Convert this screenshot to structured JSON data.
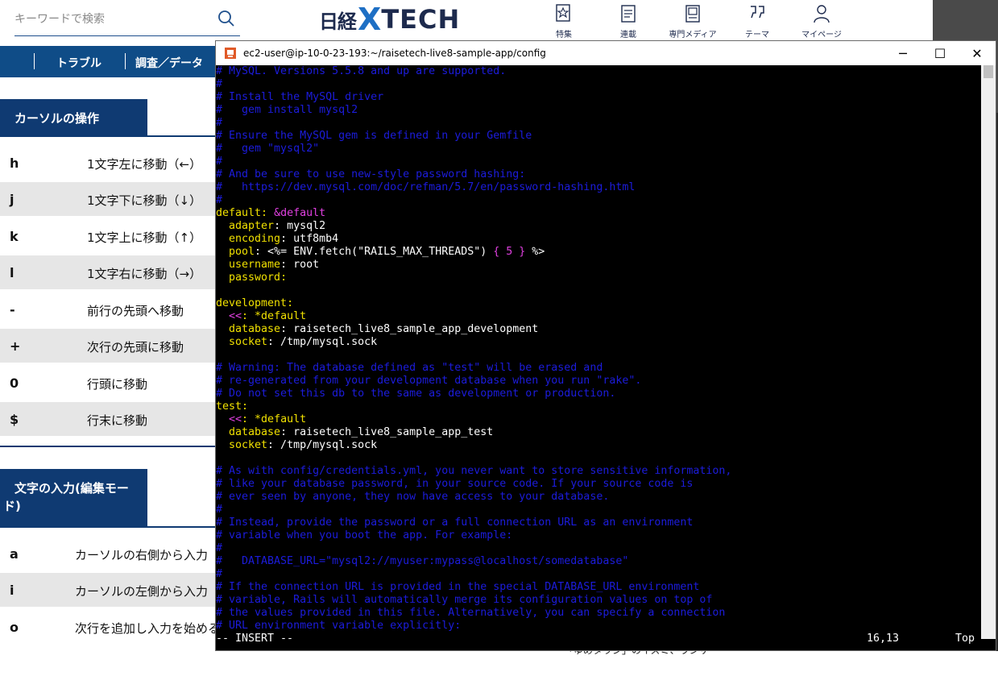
{
  "header": {
    "search_placeholder": "キーワードで検索",
    "logo_nikkei": "日経",
    "logo_x": "X",
    "logo_tech": "TECH",
    "nav": [
      {
        "label": "特集",
        "icon": "star-doc-icon"
      },
      {
        "label": "連載",
        "icon": "document-icon"
      },
      {
        "label": "専門メディア",
        "icon": "magazine-icon"
      },
      {
        "label": "テーマ",
        "icon": "theme-icon"
      },
      {
        "label": "マイページ",
        "icon": "user-icon"
      }
    ]
  },
  "bluebar": {
    "items": [
      "トラブル",
      "調査／データ"
    ]
  },
  "section1": {
    "title": "カーソルの操作",
    "rows": [
      {
        "key": "h",
        "desc": "1文字左に移動（←）"
      },
      {
        "key": "j",
        "desc": "1文字下に移動（↓）"
      },
      {
        "key": "k",
        "desc": "1文字上に移動（↑）"
      },
      {
        "key": "l",
        "desc": "1文字右に移動（→）"
      },
      {
        "key": "-",
        "desc": "前行の先頭へ移動"
      },
      {
        "key": "+",
        "desc": "次行の先頭に移動"
      },
      {
        "key": "0",
        "desc": "行頭に移動"
      },
      {
        "key": "$",
        "desc": "行末に移動"
      }
    ]
  },
  "section2": {
    "title_line1": "文字の入力(編集モー",
    "title_line2": "ド)",
    "rows": [
      {
        "key": "a",
        "desc": "カーソルの右側から入力"
      },
      {
        "key": "i",
        "desc": "カーソルの左側から入力"
      },
      {
        "key": "o",
        "desc": "次行を追加し入力を始める"
      }
    ]
  },
  "bottom_peek": "「ゆめタウン」のイズミ、ランサ",
  "window": {
    "title": "ec2-user@ip-10-0-23-193:~/raisetech-live8-sample-app/config",
    "minimize": "─",
    "maximize": "☐",
    "close": "✕"
  },
  "terminal": {
    "l01": "# MySQL. Versions 5.5.8 and up are supported.",
    "l02": "#",
    "l03": "# Install the MySQL driver",
    "l04": "#   gem install mysql2",
    "l05": "#",
    "l06": "# Ensure the MySQL gem is defined in your Gemfile",
    "l07": "#   gem \"mysql2\"",
    "l08": "#",
    "l09": "# And be sure to use new-style password hashing:",
    "l10": "#   https://dev.mysql.com/doc/refman/5.7/en/password-hashing.html",
    "l11": "#",
    "l12_key": "default",
    "l12_colon": ": ",
    "l12_val": "&default",
    "l13_key": "  adapter",
    "l13_val": ": mysql2",
    "l14_key": "  encoding",
    "l14_val": ": utf8mb4",
    "l15_key": "  pool",
    "l15_a": ": <%= ENV.fetch(\"RAILS_MAX_THREADS\") ",
    "l15_b": "{ 5 }",
    "l15_c": " %>",
    "l16_key": "  username",
    "l16_val": ": root",
    "l17_key": "  password",
    "l17_val": ":",
    "l18": "",
    "l19_key": "development",
    "l19_val": ":",
    "l20_a": "  <<",
    "l20_b": ": ",
    "l20_c": "*default",
    "l21_key": "  database",
    "l21_val": ": raisetech_live8_sample_app_development",
    "l22_key": "  socket",
    "l22_val": ": /tmp/mysql.sock",
    "l23": "",
    "l24": "# Warning: The database defined as \"test\" will be erased and",
    "l25": "# re-generated from your development database when you run \"rake\".",
    "l26": "# Do not set this db to the same as development or production.",
    "l27_key": "test",
    "l27_val": ":",
    "l28_a": "  <<",
    "l28_b": ": ",
    "l28_c": "*default",
    "l29_key": "  database",
    "l29_val": ": raisetech_live8_sample_app_test",
    "l30_key": "  socket",
    "l30_val": ": /tmp/mysql.sock",
    "l31": "",
    "l32": "# As with config/credentials.yml, you never want to store sensitive information,",
    "l33": "# like your database password, in your source code. If your source code is",
    "l34": "# ever seen by anyone, they now have access to your database.",
    "l35": "#",
    "l36": "# Instead, provide the password or a full connection URL as an environment",
    "l37": "# variable when you boot the app. For example:",
    "l38": "#",
    "l39": "#   DATABASE_URL=\"mysql2://myuser:mypass@localhost/somedatabase\"",
    "l40": "#",
    "l41": "# If the connection URL is provided in the special DATABASE_URL environment",
    "l42": "# variable, Rails will automatically merge its configuration values on top of",
    "l43": "# the values provided in this file. Alternatively, you can specify a connection",
    "l44": "# URL environment variable explicitly:",
    "status_mode": "-- INSERT --",
    "status_pos": "16,13",
    "status_top": "Top"
  },
  "colors": {
    "comment": "#1c1cdc",
    "key": "#f0e000",
    "brace": "#e040e0",
    "navy": "#0f3a72",
    "bluebar": "#0f4c87"
  }
}
